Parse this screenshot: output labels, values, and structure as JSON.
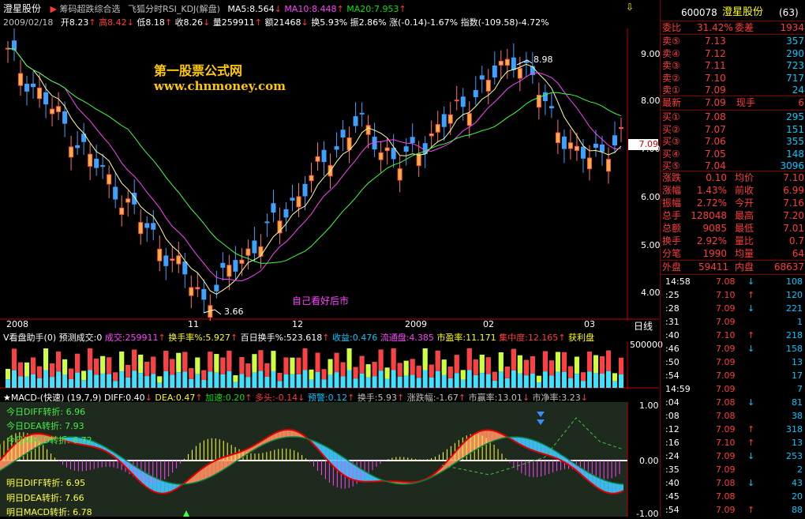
{
  "title_bar": {
    "stock_name": "澄星股份",
    "indicator_name": "筹码超跌综合选",
    "indicator2": "飞狐分时RSI_KDJ(解盘)",
    "ma5": "MA5:8.564",
    "ma10": "MA10:8.448",
    "ma20": "MA20:7.953"
  },
  "info_line": {
    "date": "2009/02/18",
    "open": "开8.23",
    "high": "高8.42",
    "low": "低8.18",
    "close": "收8.26",
    "volume": "量259911",
    "amount": "额21468",
    "turnover": "换5.93%",
    "amplitude": "振2.86%",
    "change": "涨(-0.14)-1.67%",
    "index": "指数(-109.58)-4.72%"
  },
  "watermark": {
    "line1": "第一股票公式网",
    "line2": "www.chnmoney.com"
  },
  "annotations": {
    "high_label": "8.98",
    "low_label": "3.66",
    "note": "自己看好后市",
    "price_tag": "7.09"
  },
  "price_axis": [
    "9.00",
    "8.00",
    "7.00",
    "6.00",
    "5.00",
    "4.00"
  ],
  "time_axis": [
    "2008",
    "11",
    "12",
    "2009",
    "02",
    "03"
  ],
  "period_label": "日线",
  "volume_bar": {
    "label": "V看盘助手(0)",
    "forecast": "预测成交:0",
    "volume": "成交:259911",
    "turnover": "换手率%:5.927",
    "hundred": "百日换手%:523.618",
    "income": "收益:0.476",
    "float": "流通盘:4.385",
    "pe": "市盈率:11.171",
    "conc": "集中度:12.165",
    "profit": "获利盘",
    "axis": "500000"
  },
  "macd_bar": {
    "label": "★MACD-(快速)",
    "params": "(19,7,9)",
    "diff": "DIFF:0.40",
    "dea": "DEA:0.47",
    "accel": "加速:0.20",
    "bull": "多头:-0.14",
    "warn": "预警:0.12",
    "hs": "换手:5.93",
    "zdf": "涨跌幅:-1.67",
    "syl": "市赢率:13.01",
    "sjl": "市净率:3.23",
    "axis": [
      "1.00",
      "0.00",
      "-1.00"
    ]
  },
  "macd_notes": [
    "今日DIFF转折: 6.96",
    "今日DEA转折: 7.93",
    "今日MACD转折: 6.72",
    "明日DIFF转折: 6.95",
    "明日DEA转折: 7.66",
    "明日MACD转折: 6.78"
  ],
  "panel": {
    "code": "600078",
    "name": "澄星股份",
    "count": "(63)",
    "weibi": {
      "label": "委比",
      "pct": "31.42%",
      "label2": "委差",
      "diff": "1934"
    },
    "sells": [
      {
        "label": "卖⑤",
        "price": "7.13",
        "vol": "357"
      },
      {
        "label": "卖④",
        "price": "7.12",
        "vol": "290"
      },
      {
        "label": "卖③",
        "price": "7.11",
        "vol": "723"
      },
      {
        "label": "卖②",
        "price": "7.10",
        "vol": "717"
      },
      {
        "label": "卖①",
        "price": "7.09",
        "vol": "24"
      }
    ],
    "latest": {
      "label": "最新",
      "price": "7.09",
      "label2": "现手",
      "vol": "6"
    },
    "buys": [
      {
        "label": "买①",
        "price": "7.08",
        "vol": "295"
      },
      {
        "label": "买②",
        "price": "7.07",
        "vol": "151"
      },
      {
        "label": "买③",
        "price": "7.06",
        "vol": "355"
      },
      {
        "label": "买④",
        "price": "7.05",
        "vol": "148"
      },
      {
        "label": "买⑤",
        "price": "7.04",
        "vol": "3096"
      }
    ],
    "stats": [
      {
        "l1": "涨跌",
        "v1": "0.10",
        "l2": "均价",
        "v2": "7.10"
      },
      {
        "l1": "涨幅",
        "v1": "1.43%",
        "l2": "前收",
        "v2": "6.99"
      },
      {
        "l1": "振幅",
        "v1": "2.72%",
        "l2": "今开",
        "v2": "7.16"
      },
      {
        "l1": "总手",
        "v1": "128048",
        "l2": "最高",
        "v2": "7.20"
      },
      {
        "l1": "总额",
        "v1": "9085",
        "l2": "最低",
        "v2": "7.01"
      },
      {
        "l1": "换手",
        "v1": "2.92%",
        "l2": "量比",
        "v2": "0.7"
      },
      {
        "l1": "分笔",
        "v1": "1990",
        "l2": "均量",
        "v2": "64"
      }
    ],
    "outer": {
      "label": "外盘",
      "vol": "59411",
      "label2": "内盘",
      "vol2": "68637"
    },
    "ticks": [
      {
        "t": "14:58",
        "p": "7.08",
        "d": "↓",
        "v": "108"
      },
      {
        "t": ":25",
        "p": "7.10",
        "d": "↑",
        "v": "120"
      },
      {
        "t": ":28",
        "p": "7.09",
        "d": "↓",
        "v": "221"
      },
      {
        "t": ":31",
        "p": "7.09",
        "d": "",
        "v": "1"
      },
      {
        "t": ":40",
        "p": "7.10",
        "d": "↑",
        "v": "218"
      },
      {
        "t": ":46",
        "p": "7.09",
        "d": "↓",
        "v": "158"
      },
      {
        "t": ":50",
        "p": "7.09",
        "d": "",
        "v": "13"
      },
      {
        "t": ":54",
        "p": "7.09",
        "d": "",
        "v": "17"
      },
      {
        "t": "14:59",
        "p": "7.09",
        "d": "",
        "v": "7"
      },
      {
        "t": ":04",
        "p": "7.08",
        "d": "↓",
        "v": "81"
      },
      {
        "t": ":08",
        "p": "7.08",
        "d": "",
        "v": "38"
      },
      {
        "t": ":12",
        "p": "7.09",
        "d": "↑",
        "v": "318"
      },
      {
        "t": ":16",
        "p": "7.10",
        "d": "↑",
        "v": "13"
      },
      {
        "t": ":24",
        "p": "7.09",
        "d": "↓",
        "v": "253"
      },
      {
        "t": ":35",
        "p": "7.09",
        "d": "",
        "v": "2"
      },
      {
        "t": ":40",
        "p": "7.08",
        "d": "↓",
        "v": "43"
      },
      {
        "t": ":45",
        "p": "7.08",
        "d": "",
        "v": "20"
      },
      {
        "t": ":54",
        "p": "7.09",
        "d": "↑",
        "v": "88"
      }
    ]
  }
}
